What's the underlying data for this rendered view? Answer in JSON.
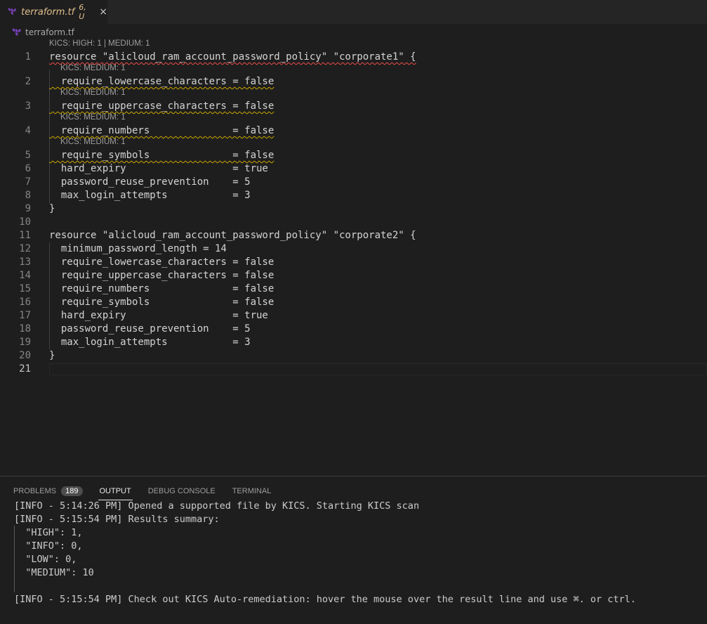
{
  "tab": {
    "name": "terraform.tf",
    "badge": "6, U",
    "icon": "terraform-icon",
    "close": "×"
  },
  "breadcrumb": {
    "file": "terraform.tf",
    "icon": "terraform-icon"
  },
  "editor": {
    "lenses": [
      {
        "text": "KICS: HIGH: 1 | MEDIUM: 1",
        "indent": 0
      },
      {
        "text": "KICS: MEDIUM: 1",
        "indent": 1
      },
      {
        "text": "KICS: MEDIUM: 1",
        "indent": 1
      },
      {
        "text": "KICS: MEDIUM: 1",
        "indent": 1
      },
      {
        "text": "KICS: MEDIUM: 1",
        "indent": 1
      }
    ],
    "lines": [
      {
        "num": "1",
        "text": "resource \"alicloud_ram_account_password_policy\" \"corporate1\" {"
      },
      {
        "num": "2",
        "text": "  require_lowercase_characters = false"
      },
      {
        "num": "3",
        "text": "  require_uppercase_characters = false"
      },
      {
        "num": "4",
        "text": "  require_numbers              = false"
      },
      {
        "num": "5",
        "text": "  require_symbols              = false"
      },
      {
        "num": "6",
        "text": "  hard_expiry                  = true"
      },
      {
        "num": "7",
        "text": "  password_reuse_prevention    = 5"
      },
      {
        "num": "8",
        "text": "  max_login_attempts           = 3"
      },
      {
        "num": "9",
        "text": "}"
      },
      {
        "num": "10",
        "text": ""
      },
      {
        "num": "11",
        "text": "resource \"alicloud_ram_account_password_policy\" \"corporate2\" {"
      },
      {
        "num": "12",
        "text": "  minimum_password_length = 14"
      },
      {
        "num": "13",
        "text": "  require_lowercase_characters = false"
      },
      {
        "num": "14",
        "text": "  require_uppercase_characters = false"
      },
      {
        "num": "15",
        "text": "  require_numbers              = false"
      },
      {
        "num": "16",
        "text": "  require_symbols              = false"
      },
      {
        "num": "17",
        "text": "  hard_expiry                  = true"
      },
      {
        "num": "18",
        "text": "  password_reuse_prevention    = 5"
      },
      {
        "num": "19",
        "text": "  max_login_attempts           = 3"
      },
      {
        "num": "20",
        "text": "}"
      },
      {
        "num": "21",
        "text": ""
      }
    ]
  },
  "panel": {
    "tabs": [
      {
        "label": "PROBLEMS",
        "badge": "189"
      },
      {
        "label": "OUTPUT"
      },
      {
        "label": "DEBUG CONSOLE"
      },
      {
        "label": "TERMINAL"
      }
    ],
    "output": [
      "[INFO - 5:14:26 PM] Opened a supported file by KICS. Starting KICS scan",
      "[INFO - 5:15:54 PM] Results summary:",
      "  \"HIGH\": 1,",
      "  \"INFO\": 0,",
      "  \"LOW\": 0,",
      "  \"MEDIUM\": 10",
      "",
      "[INFO - 5:15:54 PM] Check out KICS Auto-remediation: hover the mouse over the result line and use ⌘. or ctrl."
    ]
  },
  "colors": {
    "accent_tab": "#e2c08d",
    "error": "#f14c4c",
    "warning": "#cca700",
    "terraform": "#7b42bc"
  }
}
